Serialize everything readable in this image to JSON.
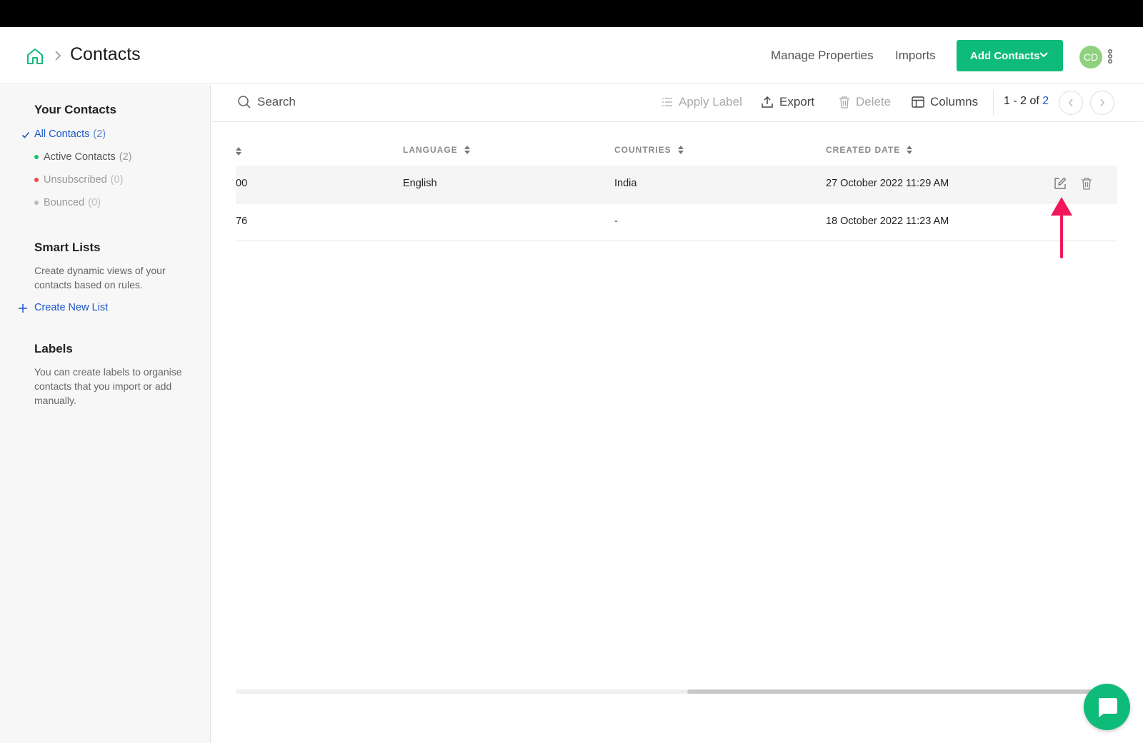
{
  "header": {
    "page_title": "Contacts",
    "manage_properties": "Manage Properties",
    "imports": "Imports",
    "add_contacts": "Add Contacts",
    "avatar_initials": "CD"
  },
  "sidebar": {
    "your_contacts_heading": "Your Contacts",
    "items": [
      {
        "label": "All Contacts",
        "count": "(2)",
        "state": "selected"
      },
      {
        "label": "Active Contacts",
        "count": "(2)",
        "dot_color": "#1fbf6a"
      },
      {
        "label": "Unsubscribed",
        "count": "(0)",
        "dot_color": "#ee4444"
      },
      {
        "label": "Bounced",
        "count": "(0)",
        "dot_color": "#bbbbbb"
      }
    ],
    "smart_lists_heading": "Smart Lists",
    "smart_lists_desc": "Create dynamic views of your contacts based on rules.",
    "create_new_list": "Create New List",
    "labels_heading": "Labels",
    "labels_desc": "You can create labels to organise contacts that you import or add manually."
  },
  "toolbar": {
    "search_placeholder": "Search",
    "apply_label": "Apply Label",
    "export": "Export",
    "delete": "Delete",
    "columns": "Columns",
    "pager_range": "1 - 2",
    "pager_of": "of",
    "pager_total": "2"
  },
  "table": {
    "columns": [
      "LANGUAGE",
      "COUNTRIES",
      "CREATED DATE"
    ],
    "rows": [
      {
        "partial": "00",
        "language": "English",
        "country": "India",
        "created": "27 October 2022 11:29 AM"
      },
      {
        "partial": "76",
        "language": "",
        "country": "-",
        "created": "18 October 2022 11:23 AM"
      }
    ]
  },
  "colors": {
    "accent_green": "#0fbb78",
    "link_blue": "#1a56c9",
    "annotation_arrow": "#f0185a"
  },
  "icons": [
    "home-icon",
    "chevron-right-icon",
    "chevron-down-icon",
    "kebab-icon",
    "search-icon",
    "list-icon",
    "upload-icon",
    "trash-icon",
    "columns-icon",
    "chevron-left-icon",
    "edit-icon",
    "chat-icon",
    "plus-icon",
    "check-icon"
  ]
}
